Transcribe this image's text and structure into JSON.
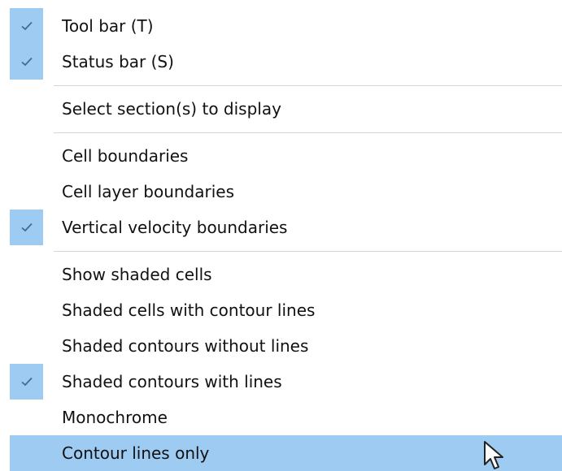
{
  "menu": {
    "items": [
      {
        "label": "Tool bar (T)",
        "checked": true
      },
      {
        "label": "Status bar (S)",
        "checked": true
      },
      {
        "label": "Select section(s) to display",
        "checked": false
      },
      {
        "label": "Cell boundaries",
        "checked": false
      },
      {
        "label": "Cell layer boundaries",
        "checked": false
      },
      {
        "label": "Vertical velocity boundaries",
        "checked": true
      },
      {
        "label": "Show shaded cells",
        "checked": false
      },
      {
        "label": "Shaded cells with contour lines",
        "checked": false
      },
      {
        "label": "Shaded contours without lines",
        "checked": false
      },
      {
        "label": "Shaded contours with lines",
        "checked": true
      },
      {
        "label": "Monochrome",
        "checked": false
      },
      {
        "label": "Contour lines only",
        "checked": false,
        "highlighted": true
      }
    ]
  },
  "colors": {
    "check_background": "#9dcbf2",
    "hover_background": "#9dcbf2",
    "checkmark": "#3d6e99",
    "separator": "#d4d4d4",
    "text": "#111111"
  },
  "icons": {
    "checkmark": "check-icon",
    "cursor": "mouse-pointer-icon"
  }
}
